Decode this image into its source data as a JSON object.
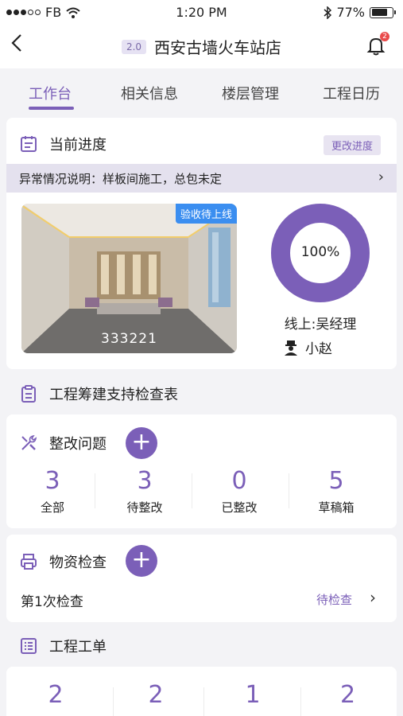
{
  "status_bar": {
    "carrier": "FB",
    "time": "1:20 PM",
    "battery": "77%",
    "battery_level": 0.77
  },
  "nav": {
    "version": "2.0",
    "title": "西安古墙火车站店",
    "bell_count": "2"
  },
  "tabs": [
    {
      "label": "工作台",
      "active": true
    },
    {
      "label": "相关信息",
      "active": false
    },
    {
      "label": "楼层管理",
      "active": false
    },
    {
      "label": "工程日历",
      "active": false
    }
  ],
  "progress": {
    "title": "当前进度",
    "change_button": "更改进度",
    "notice": "异常情况说明：样板间施工，总包未定",
    "photo_tag": "验收待上线",
    "photo_caption": "333221",
    "percent_label": "100%",
    "percent": 100,
    "manager": "线上:吴经理",
    "person": "小赵"
  },
  "checklist": {
    "title": "工程筹建支持检查表"
  },
  "rectify": {
    "title": "整改问题",
    "stats": [
      {
        "num": "3",
        "label": "全部"
      },
      {
        "num": "3",
        "label": "待整改"
      },
      {
        "num": "0",
        "label": "已整改"
      },
      {
        "num": "5",
        "label": "草稿箱"
      }
    ]
  },
  "materials": {
    "title": "物资检查",
    "item": "第1次检查",
    "status": "待检查"
  },
  "orders": {
    "title": "工程工单",
    "stats": [
      {
        "num": "2"
      },
      {
        "num": "2"
      },
      {
        "num": "1"
      },
      {
        "num": "2"
      }
    ]
  },
  "colors": {
    "accent": "#7b5fb8",
    "tag_blue": "#3b8ef0",
    "badge_red": "#e94a4a"
  }
}
